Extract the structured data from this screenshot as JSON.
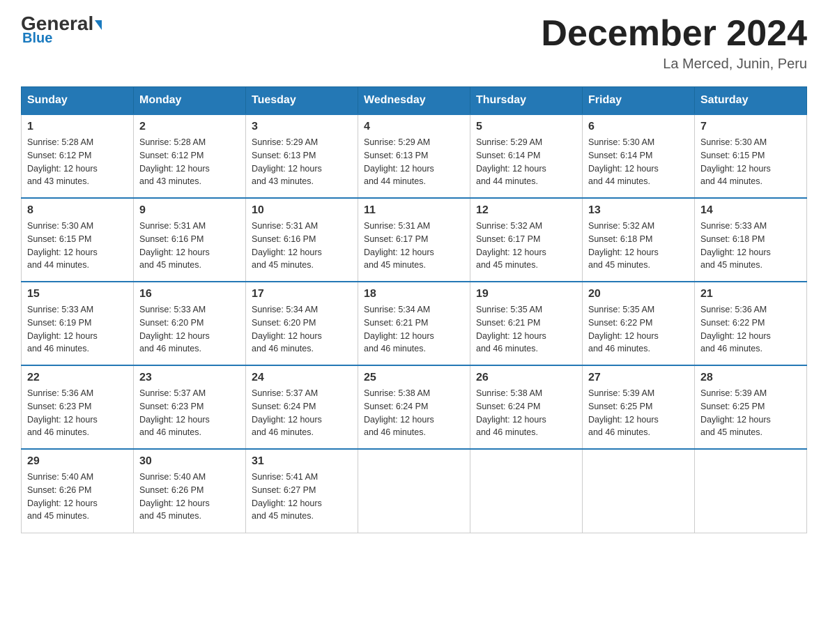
{
  "header": {
    "logo_general": "General",
    "logo_blue": "Blue",
    "month_title": "December 2024",
    "location": "La Merced, Junin, Peru"
  },
  "days_of_week": [
    "Sunday",
    "Monday",
    "Tuesday",
    "Wednesday",
    "Thursday",
    "Friday",
    "Saturday"
  ],
  "weeks": [
    [
      {
        "day": "1",
        "sunrise": "5:28 AM",
        "sunset": "6:12 PM",
        "daylight": "12 hours and 43 minutes."
      },
      {
        "day": "2",
        "sunrise": "5:28 AM",
        "sunset": "6:12 PM",
        "daylight": "12 hours and 43 minutes."
      },
      {
        "day": "3",
        "sunrise": "5:29 AM",
        "sunset": "6:13 PM",
        "daylight": "12 hours and 43 minutes."
      },
      {
        "day": "4",
        "sunrise": "5:29 AM",
        "sunset": "6:13 PM",
        "daylight": "12 hours and 44 minutes."
      },
      {
        "day": "5",
        "sunrise": "5:29 AM",
        "sunset": "6:14 PM",
        "daylight": "12 hours and 44 minutes."
      },
      {
        "day": "6",
        "sunrise": "5:30 AM",
        "sunset": "6:14 PM",
        "daylight": "12 hours and 44 minutes."
      },
      {
        "day": "7",
        "sunrise": "5:30 AM",
        "sunset": "6:15 PM",
        "daylight": "12 hours and 44 minutes."
      }
    ],
    [
      {
        "day": "8",
        "sunrise": "5:30 AM",
        "sunset": "6:15 PM",
        "daylight": "12 hours and 44 minutes."
      },
      {
        "day": "9",
        "sunrise": "5:31 AM",
        "sunset": "6:16 PM",
        "daylight": "12 hours and 45 minutes."
      },
      {
        "day": "10",
        "sunrise": "5:31 AM",
        "sunset": "6:16 PM",
        "daylight": "12 hours and 45 minutes."
      },
      {
        "day": "11",
        "sunrise": "5:31 AM",
        "sunset": "6:17 PM",
        "daylight": "12 hours and 45 minutes."
      },
      {
        "day": "12",
        "sunrise": "5:32 AM",
        "sunset": "6:17 PM",
        "daylight": "12 hours and 45 minutes."
      },
      {
        "day": "13",
        "sunrise": "5:32 AM",
        "sunset": "6:18 PM",
        "daylight": "12 hours and 45 minutes."
      },
      {
        "day": "14",
        "sunrise": "5:33 AM",
        "sunset": "6:18 PM",
        "daylight": "12 hours and 45 minutes."
      }
    ],
    [
      {
        "day": "15",
        "sunrise": "5:33 AM",
        "sunset": "6:19 PM",
        "daylight": "12 hours and 46 minutes."
      },
      {
        "day": "16",
        "sunrise": "5:33 AM",
        "sunset": "6:20 PM",
        "daylight": "12 hours and 46 minutes."
      },
      {
        "day": "17",
        "sunrise": "5:34 AM",
        "sunset": "6:20 PM",
        "daylight": "12 hours and 46 minutes."
      },
      {
        "day": "18",
        "sunrise": "5:34 AM",
        "sunset": "6:21 PM",
        "daylight": "12 hours and 46 minutes."
      },
      {
        "day": "19",
        "sunrise": "5:35 AM",
        "sunset": "6:21 PM",
        "daylight": "12 hours and 46 minutes."
      },
      {
        "day": "20",
        "sunrise": "5:35 AM",
        "sunset": "6:22 PM",
        "daylight": "12 hours and 46 minutes."
      },
      {
        "day": "21",
        "sunrise": "5:36 AM",
        "sunset": "6:22 PM",
        "daylight": "12 hours and 46 minutes."
      }
    ],
    [
      {
        "day": "22",
        "sunrise": "5:36 AM",
        "sunset": "6:23 PM",
        "daylight": "12 hours and 46 minutes."
      },
      {
        "day": "23",
        "sunrise": "5:37 AM",
        "sunset": "6:23 PM",
        "daylight": "12 hours and 46 minutes."
      },
      {
        "day": "24",
        "sunrise": "5:37 AM",
        "sunset": "6:24 PM",
        "daylight": "12 hours and 46 minutes."
      },
      {
        "day": "25",
        "sunrise": "5:38 AM",
        "sunset": "6:24 PM",
        "daylight": "12 hours and 46 minutes."
      },
      {
        "day": "26",
        "sunrise": "5:38 AM",
        "sunset": "6:24 PM",
        "daylight": "12 hours and 46 minutes."
      },
      {
        "day": "27",
        "sunrise": "5:39 AM",
        "sunset": "6:25 PM",
        "daylight": "12 hours and 46 minutes."
      },
      {
        "day": "28",
        "sunrise": "5:39 AM",
        "sunset": "6:25 PM",
        "daylight": "12 hours and 45 minutes."
      }
    ],
    [
      {
        "day": "29",
        "sunrise": "5:40 AM",
        "sunset": "6:26 PM",
        "daylight": "12 hours and 45 minutes."
      },
      {
        "day": "30",
        "sunrise": "5:40 AM",
        "sunset": "6:26 PM",
        "daylight": "12 hours and 45 minutes."
      },
      {
        "day": "31",
        "sunrise": "5:41 AM",
        "sunset": "6:27 PM",
        "daylight": "12 hours and 45 minutes."
      },
      null,
      null,
      null,
      null
    ]
  ],
  "labels": {
    "sunrise": "Sunrise:",
    "sunset": "Sunset:",
    "daylight": "Daylight:"
  }
}
